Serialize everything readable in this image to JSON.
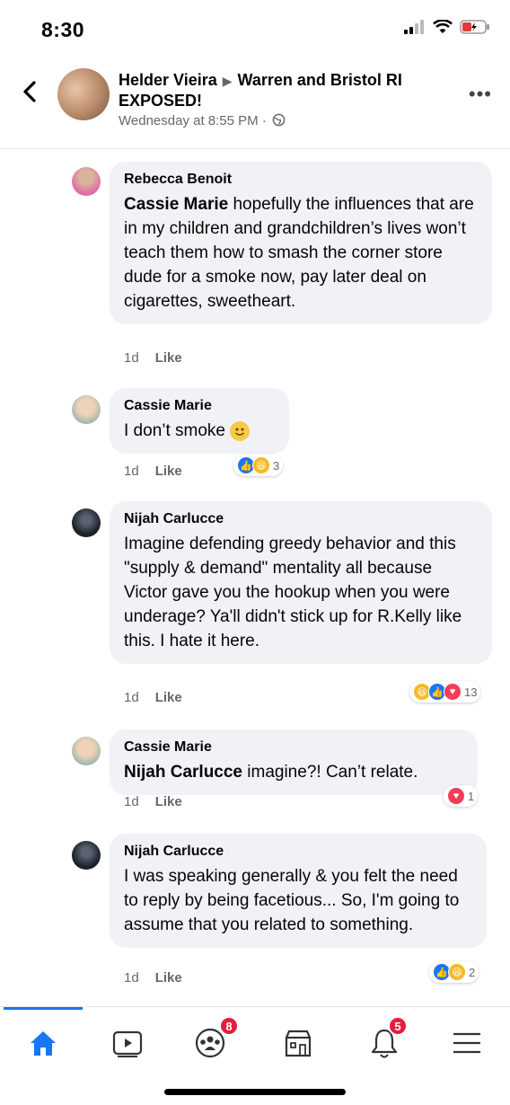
{
  "status_bar": {
    "time": "8:30"
  },
  "header": {
    "author": "Helder Vieira",
    "group": "Warren and Bristol RI EXPOSED!",
    "timestamp": "Wednesday at 8:55 PM ·"
  },
  "comments": [
    {
      "name": "Rebecca Benoit",
      "mention": "Cassie Marie",
      "text": " hopefully the influences that are in my children and grandchildren’s lives won’t teach them how to smash the corner store dude for a smoke now, pay later deal on cigarettes, sweetheart.",
      "age": "1d",
      "like": "Like",
      "reaction_count": ""
    },
    {
      "name": "Cassie Marie",
      "mention": "",
      "text": "I don’t smoke",
      "age": "1d",
      "like": "Like",
      "reaction_count": "3"
    },
    {
      "name": "Nijah Carlucce",
      "mention": "",
      "text": "Imagine defending greedy behavior and this \"supply & demand\" mentality all because Victor gave you the hookup when you were underage? Ya'll didn't stick up for R.Kelly like this. I hate it here.",
      "age": "1d",
      "like": "Like",
      "reaction_count": "13"
    },
    {
      "name": "Cassie Marie",
      "mention": "Nijah Carlucce",
      "text": " imagine?! Can’t relate.",
      "age": "1d",
      "like": "Like",
      "reaction_count": "1"
    },
    {
      "name": "Nijah Carlucce",
      "mention": "",
      "text": "I was speaking generally & you felt the need to reply by being facetious... So, I'm going to assume that you related to something.",
      "age": "1d",
      "like": "Like",
      "reaction_count": "2"
    }
  ],
  "nav": {
    "groups_badge": "8",
    "notifications_badge": "5"
  },
  "colors": {
    "accent": "#1877f2",
    "badge": "#e41e3f",
    "bubble": "#f0f2f5"
  }
}
